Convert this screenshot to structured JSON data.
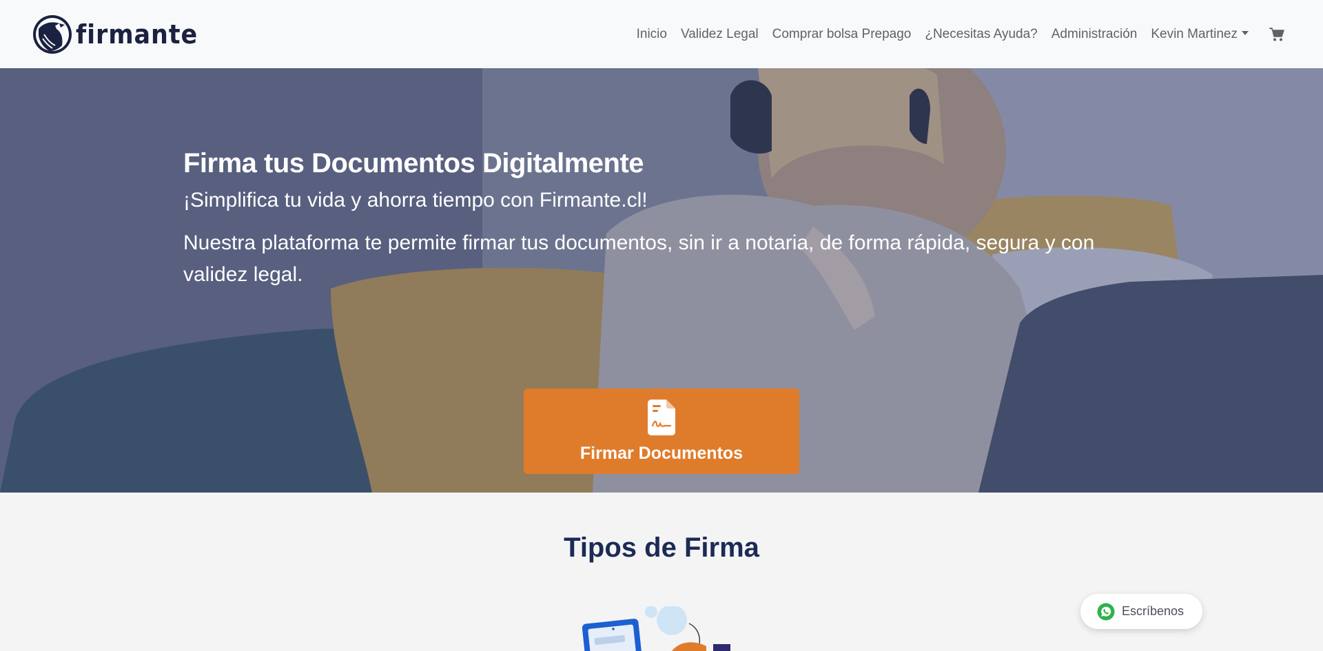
{
  "brand": {
    "name": "firmante",
    "logo_icon": "eagle-logo-icon"
  },
  "nav": {
    "links": [
      "Inicio",
      "Validez Legal",
      "Comprar bolsa Prepago",
      "¿Necesitas Ayuda?",
      "Administración"
    ],
    "user": "Kevin Martinez",
    "cart_icon": "cart-icon"
  },
  "hero": {
    "title": "Firma tus Documentos Digitalmente",
    "subtitle": "¡Simplifica tu vida y ahorra tiempo con Firmante.cl!",
    "description": "Nuestra plataforma te permite firmar tus documentos, sin ir a notaria, de forma rápida, segura y con validez legal.",
    "cta_label": "Firmar Documentos",
    "cta_icon": "signed-document-icon"
  },
  "section": {
    "title": "Tipos de Firma"
  },
  "whatsapp": {
    "label": "Escríbenos",
    "icon": "whatsapp-icon"
  },
  "colors": {
    "accent": "#df7c2c",
    "navy": "#1c2a55",
    "nav_text": "#5e6269",
    "navbar_bg": "#f8f9fa"
  }
}
